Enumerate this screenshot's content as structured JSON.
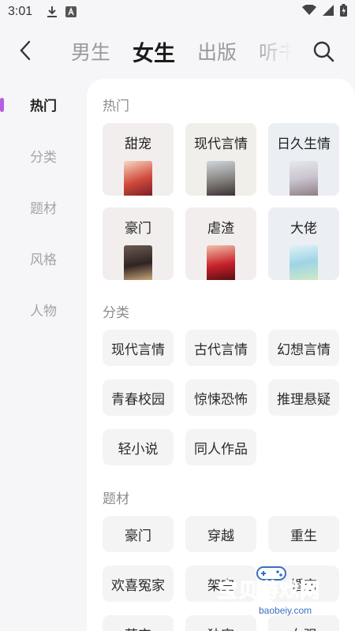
{
  "status_bar": {
    "time": "3:01",
    "left_icons": [
      "download-icon",
      "app-icon"
    ],
    "right_icons": [
      "wifi-icon",
      "signal-icon",
      "battery-icon"
    ]
  },
  "nav": {
    "tabs": [
      {
        "label": "男生",
        "active": false
      },
      {
        "label": "女生",
        "active": true
      },
      {
        "label": "出版",
        "active": false
      },
      {
        "label": "听书",
        "active": false
      }
    ]
  },
  "sidebar": {
    "items": [
      {
        "label": "热门",
        "active": true
      },
      {
        "label": "分类",
        "active": false
      },
      {
        "label": "题材",
        "active": false
      },
      {
        "label": "风格",
        "active": false
      },
      {
        "label": "人物",
        "active": false
      }
    ],
    "accent": "#b95ee0"
  },
  "sections": {
    "hot": {
      "title": "热门",
      "cards": [
        {
          "label": "甜宠",
          "bg": "#f3eeee"
        },
        {
          "label": "现代言情",
          "bg": "#f1efea"
        },
        {
          "label": "日久生情",
          "bg": "#ebeef3"
        },
        {
          "label": "豪门",
          "bg": "#f3eeee"
        },
        {
          "label": "虐渣",
          "bg": "#f3eeee"
        },
        {
          "label": "大佬",
          "bg": "#ebeef3"
        }
      ]
    },
    "category": {
      "title": "分类",
      "items": [
        "现代言情",
        "古代言情",
        "幻想言情",
        "青春校园",
        "惊悚恐怖",
        "推理悬疑",
        "轻小说",
        "同人作品"
      ]
    },
    "theme": {
      "title": "题材",
      "items": [
        "豪门",
        "穿越",
        "重生",
        "欢喜冤家",
        "架空",
        "婚恋",
        "萌宝",
        "独宠",
        "女强"
      ]
    }
  },
  "watermark": {
    "text": "宝贝游戏网",
    "url": "baobeiy.com"
  }
}
